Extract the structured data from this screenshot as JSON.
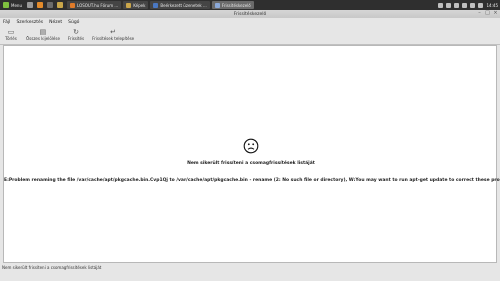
{
  "taskbar": {
    "menu_label": "Menu",
    "tasks": [
      {
        "label": "LOSOUT.hu Fórum ...",
        "color": "#e07b2a"
      },
      {
        "label": "Képek",
        "color": "#caa64a"
      },
      {
        "label": "Beérkezett üzenetek ...",
        "color": "#4a78c2"
      },
      {
        "label": "Frissítéskezelő",
        "color": "#8aa8d8"
      }
    ],
    "active_task_index": 3,
    "clock": "14:45"
  },
  "window": {
    "title": "Frissítéskezelő",
    "menu": [
      "Fájl",
      "Szerkesztés",
      "Nézet",
      "Súgó"
    ],
    "toolbar": [
      {
        "label": "Törlés",
        "icon": "clear-icon"
      },
      {
        "label": "Összes kijelölése",
        "icon": "select-all-icon"
      },
      {
        "label": "Frissítés",
        "icon": "refresh-icon"
      },
      {
        "label": "Frissítések telepítése",
        "icon": "install-updates-icon"
      }
    ],
    "message_title": "Nem sikerült frissíteni a csomagfrissítések listáját",
    "error_text": "E:Problem renaming the file /var/cache/apt/pkgcache.bin.Cvp1Qj to /var/cache/apt/pkgcache.bin - rename (2: No such file or directory), W:You may want to run apt-get update to correct these problems",
    "status": "Nem sikerült frissíteni a csomagfrissítések listáját"
  }
}
